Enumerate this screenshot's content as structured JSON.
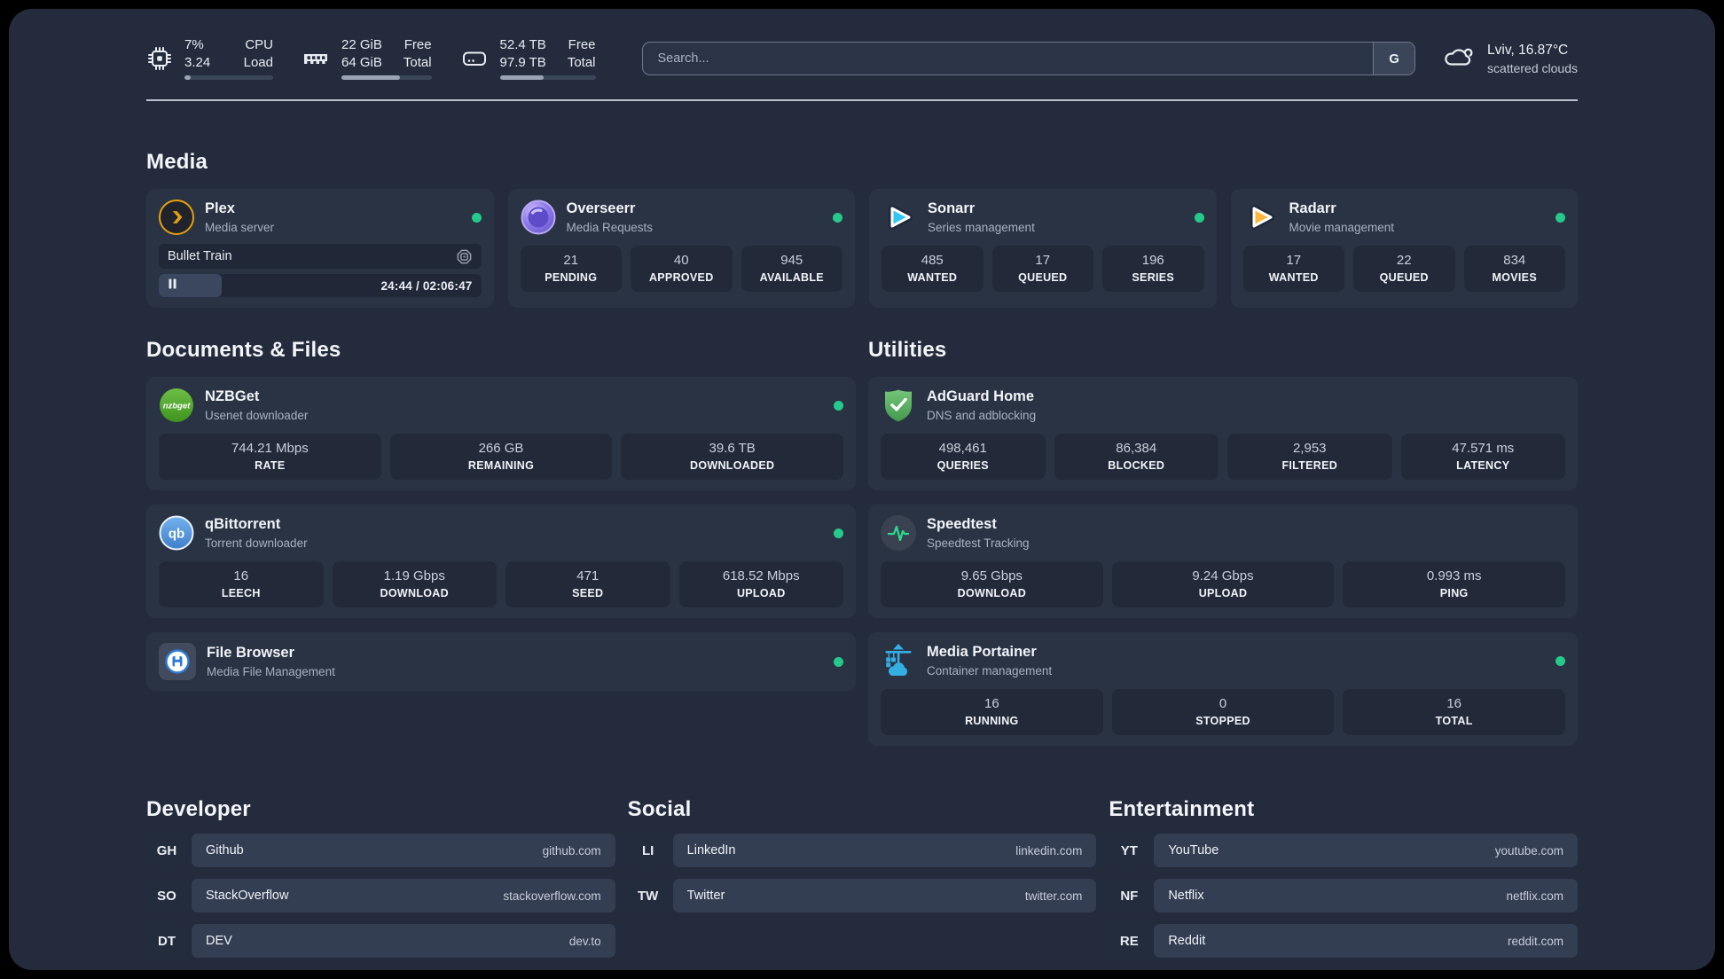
{
  "colors": {
    "status_online": "#25C98B",
    "plex_amber": "#E5A00D",
    "sonarr_cyan": "#35C5F4",
    "radarr_amber": "#FFB53C",
    "nzbget_green": "#55A832",
    "qbittorrent_blue": "#4E8FD9",
    "adguard_green": "#5CB763",
    "speedtest_green": "#2BD98A",
    "portainer_blue": "#35AFE3"
  },
  "header": {
    "resources": [
      {
        "icon": "cpu-icon",
        "value_top": "7%",
        "value_bottom": "3.24",
        "label_top": "CPU",
        "label_bottom": "Load",
        "progress_pct": 7
      },
      {
        "icon": "ram-icon",
        "value_top": "22 GiB",
        "value_bottom": "64 GiB",
        "label_top": "Free",
        "label_bottom": "Total",
        "progress_pct": 65
      },
      {
        "icon": "disk-icon",
        "value_top": "52.4 TB",
        "value_bottom": "97.9 TB",
        "label_top": "Free",
        "label_bottom": "Total",
        "progress_pct": 46
      }
    ],
    "search": {
      "placeholder": "Search...",
      "button_label": "G"
    },
    "weather": {
      "location_temp": "Lviv, 16.87°C",
      "condition": "scattered clouds"
    }
  },
  "media": {
    "title": "Media",
    "plex": {
      "name": "Plex",
      "subtitle": "Media server",
      "status": "online",
      "now_playing": "Bullet Train",
      "time": "24:44 / 02:06:47",
      "progress_pct": 19.5
    },
    "overseerr": {
      "name": "Overseerr",
      "subtitle": "Media Requests",
      "status": "online",
      "stats": [
        {
          "value": "21",
          "label": "PENDING"
        },
        {
          "value": "40",
          "label": "APPROVED"
        },
        {
          "value": "945",
          "label": "AVAILABLE"
        }
      ]
    },
    "sonarr": {
      "name": "Sonarr",
      "subtitle": "Series management",
      "status": "online",
      "stats": [
        {
          "value": "485",
          "label": "WANTED"
        },
        {
          "value": "17",
          "label": "QUEUED"
        },
        {
          "value": "196",
          "label": "SERIES"
        }
      ]
    },
    "radarr": {
      "name": "Radarr",
      "subtitle": "Movie management",
      "status": "online",
      "stats": [
        {
          "value": "17",
          "label": "WANTED"
        },
        {
          "value": "22",
          "label": "QUEUED"
        },
        {
          "value": "834",
          "label": "MOVIES"
        }
      ]
    }
  },
  "documents": {
    "title": "Documents & Files",
    "nzbget": {
      "name": "NZBGet",
      "subtitle": "Usenet downloader",
      "status": "online",
      "stats": [
        {
          "value": "744.21 Mbps",
          "label": "RATE"
        },
        {
          "value": "266 GB",
          "label": "REMAINING"
        },
        {
          "value": "39.6 TB",
          "label": "DOWNLOADED"
        }
      ]
    },
    "qbittorrent": {
      "name": "qBittorrent",
      "subtitle": "Torrent downloader",
      "status": "online",
      "stats": [
        {
          "value": "16",
          "label": "LEECH"
        },
        {
          "value": "1.19 Gbps",
          "label": "DOWNLOAD"
        },
        {
          "value": "471",
          "label": "SEED"
        },
        {
          "value": "618.52 Mbps",
          "label": "UPLOAD"
        }
      ]
    },
    "filebrowser": {
      "name": "File Browser",
      "subtitle": "Media File Management",
      "status": "online"
    }
  },
  "utilities": {
    "title": "Utilities",
    "adguard": {
      "name": "AdGuard Home",
      "subtitle": "DNS and adblocking",
      "stats": [
        {
          "value": "498,461",
          "label": "QUERIES"
        },
        {
          "value": "86,384",
          "label": "BLOCKED"
        },
        {
          "value": "2,953",
          "label": "FILTERED"
        },
        {
          "value": "47.571 ms",
          "label": "LATENCY"
        }
      ]
    },
    "speedtest": {
      "name": "Speedtest",
      "subtitle": "Speedtest Tracking",
      "stats": [
        {
          "value": "9.65 Gbps",
          "label": "DOWNLOAD"
        },
        {
          "value": "9.24 Gbps",
          "label": "UPLOAD"
        },
        {
          "value": "0.993 ms",
          "label": "PING"
        }
      ]
    },
    "portainer": {
      "name": "Media Portainer",
      "subtitle": "Container management",
      "status": "online",
      "stats": [
        {
          "value": "16",
          "label": "RUNNING"
        },
        {
          "value": "0",
          "label": "STOPPED"
        },
        {
          "value": "16",
          "label": "TOTAL"
        }
      ]
    }
  },
  "bookmarks": {
    "developer": {
      "title": "Developer",
      "items": [
        {
          "abbr": "GH",
          "name": "Github",
          "url": "github.com"
        },
        {
          "abbr": "SO",
          "name": "StackOverflow",
          "url": "stackoverflow.com"
        },
        {
          "abbr": "DT",
          "name": "DEV",
          "url": "dev.to"
        }
      ]
    },
    "social": {
      "title": "Social",
      "items": [
        {
          "abbr": "LI",
          "name": "LinkedIn",
          "url": "linkedin.com"
        },
        {
          "abbr": "TW",
          "name": "Twitter",
          "url": "twitter.com"
        }
      ]
    },
    "entertainment": {
      "title": "Entertainment",
      "items": [
        {
          "abbr": "YT",
          "name": "YouTube",
          "url": "youtube.com"
        },
        {
          "abbr": "NF",
          "name": "Netflix",
          "url": "netflix.com"
        },
        {
          "abbr": "RE",
          "name": "Reddit",
          "url": "reddit.com"
        }
      ]
    }
  }
}
